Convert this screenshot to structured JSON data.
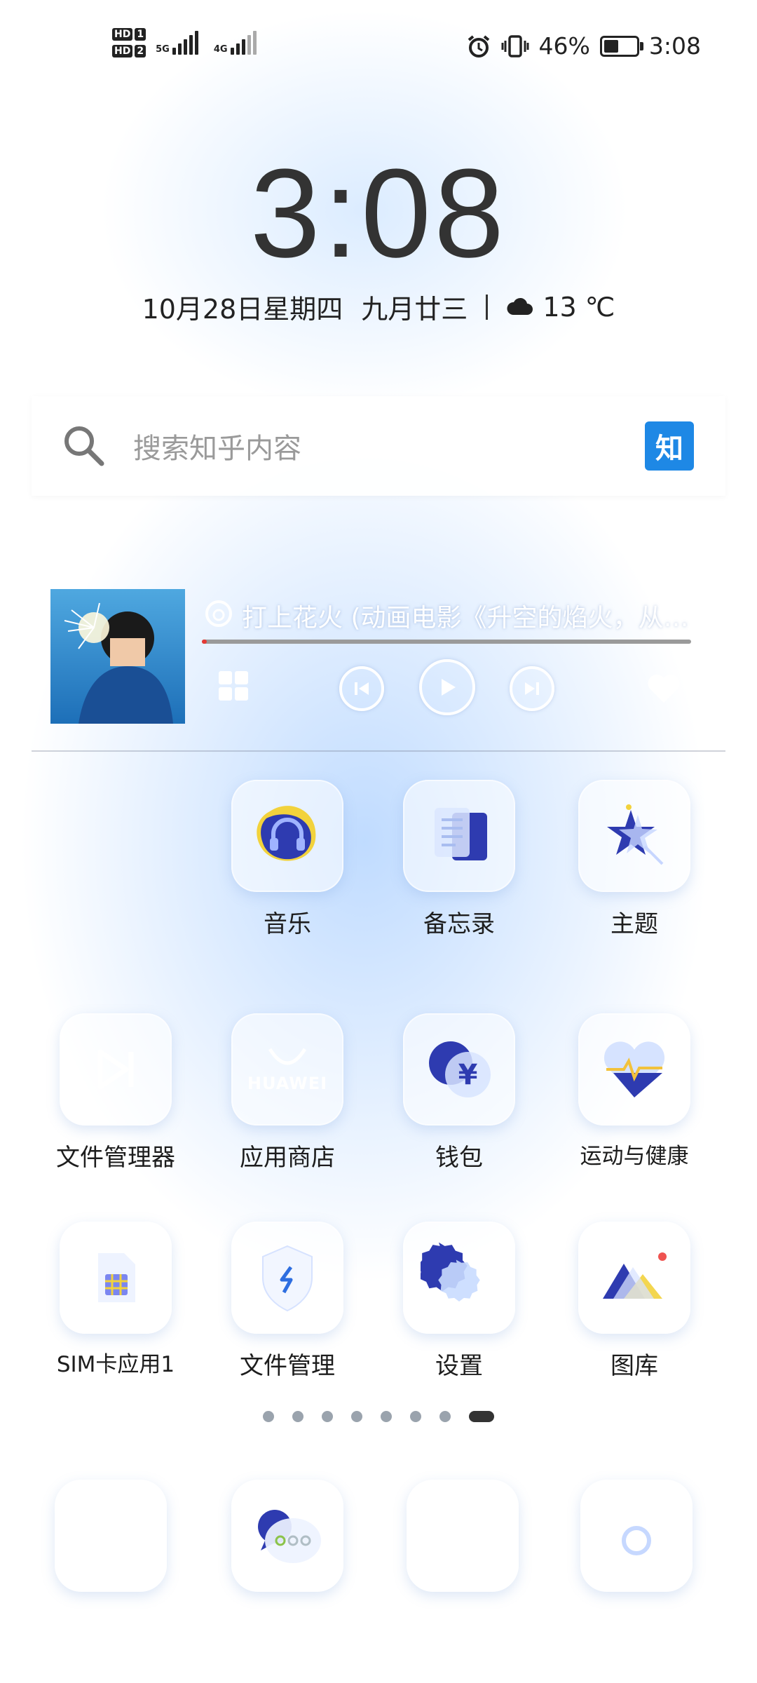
{
  "status_bar": {
    "sim1": "HD",
    "sim1_num": "1",
    "sim2": "HD",
    "sim2_num": "2",
    "net1": "5G",
    "net2": "4G",
    "battery_percent": "46%",
    "battery_level": 0.46,
    "time": "3:08"
  },
  "lockclock": {
    "time": "3:08",
    "date": "10月28日星期四",
    "lunar": "九月廿三",
    "temperature": "13 ℃"
  },
  "search": {
    "placeholder": "搜索知乎内容",
    "badge": "知"
  },
  "music": {
    "title": "打上花火 (动画电影《升空的焰火，从…",
    "progress": 0.01
  },
  "apps": [
    {
      "label": "音乐"
    },
    {
      "label": "备忘录"
    },
    {
      "label": "主题"
    },
    {
      "label": "文件管理器"
    },
    {
      "label": "应用商店",
      "brand": "HUAWEI"
    },
    {
      "label": "钱包",
      "glyph": "¥"
    },
    {
      "label": "运动与健康"
    },
    {
      "label": "SIM卡应用1"
    },
    {
      "label": "文件管理"
    },
    {
      "label": "设置"
    },
    {
      "label": "图库"
    }
  ],
  "page_indicator": {
    "count": 8,
    "active": 8
  },
  "colors": {
    "accent_blue": "#1e88e5",
    "progress_red": "#e53935"
  }
}
